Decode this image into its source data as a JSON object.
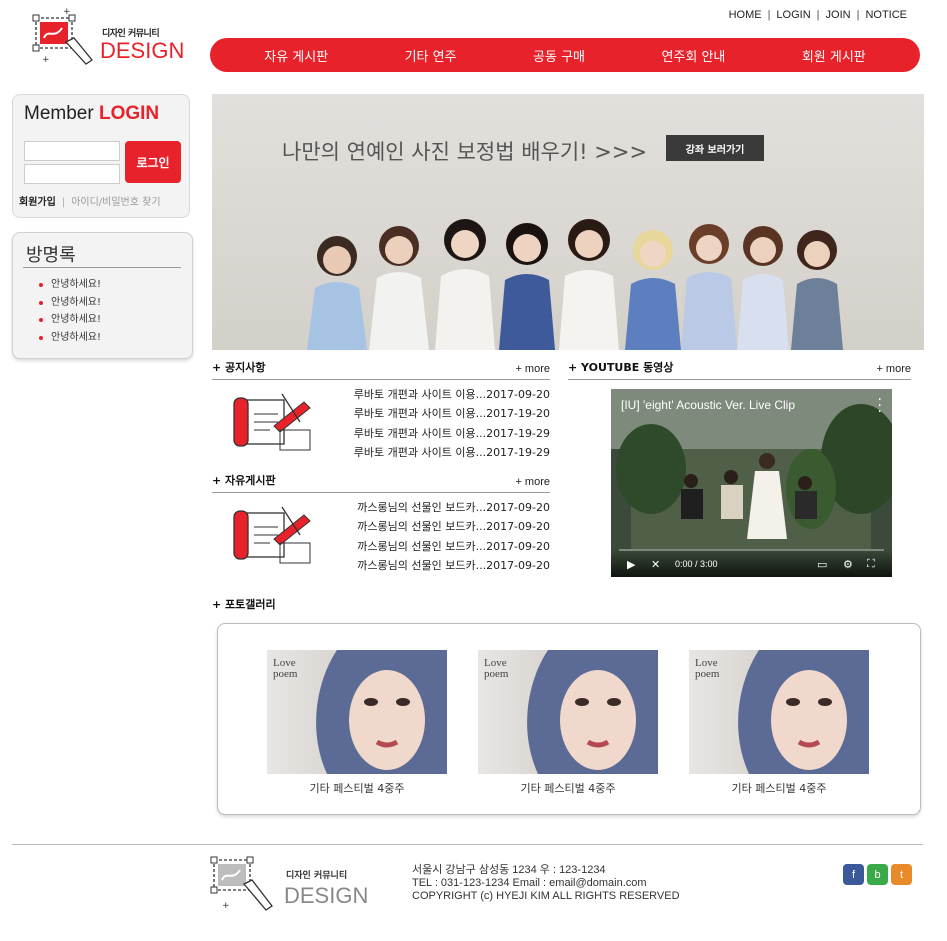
{
  "header": {
    "brand_small": "디자인 커뮤니티",
    "brand_big": "DESIGN",
    "top_links": [
      "HOME",
      "LOGIN",
      "JOIN",
      "NOTICE"
    ],
    "nav": [
      "자유 게시판",
      "기타 연주",
      "공동 구매",
      "연주회 안내",
      "회원 게시판"
    ]
  },
  "login": {
    "title_a": "Member ",
    "title_b": "LOGIN",
    "button": "로그인",
    "join": "회원가입",
    "find": "아이디/비밀번호 찾기"
  },
  "guestbook": {
    "title": "방명록",
    "items": [
      "안녕하세요!",
      "안녕하세요!",
      "안녕하세요!",
      "안녕하세요!"
    ]
  },
  "banner": {
    "text": "나만의 연예인 사진 보정법 배우기! >>>",
    "button": "강좌 보러가기"
  },
  "notice": {
    "title": "+ 공지사항",
    "more": "+ more",
    "items": [
      "루바토 개편과 사이트 이용...2017-09-20",
      "루바토 개편과 사이트 이용...2017-19-20",
      "루바토 개편과 사이트 이용...2017-19-29",
      "루바토 개편과 사이트 이용...2017-19-29"
    ]
  },
  "freeboard": {
    "title": "+ 자유게시판",
    "more": "+ more",
    "items": [
      "까스롱님의 선물인 보드카...2017-09-20",
      "까스롱님의 선물인 보드카...2017-09-20",
      "까스롱님의 선물인 보드카...2017-09-20",
      "까스롱님의 선물인 보드카...2017-09-20"
    ]
  },
  "youtube": {
    "title": "+ YOUTUBE 동영상",
    "more": "+ more",
    "video_title": "[IU] 'eight' Acoustic Ver. Live Clip",
    "time": "0:00 / 3:00"
  },
  "gallery": {
    "title": "+ 포토갤러리",
    "poster_title_1": "Love",
    "poster_title_2": "poem",
    "items": [
      {
        "caption": "기타 페스티벌 4중주"
      },
      {
        "caption": "기타 페스티벌 4중주"
      },
      {
        "caption": "기타 페스티벌 4중주"
      }
    ]
  },
  "footer": {
    "brand_small": "디자인 커뮤니티",
    "brand_big": "DESIGN",
    "address": "서울시 강남구 삼성동 1234 우 : 123-1234",
    "contact": "TEL : 031-123-1234 Email : email@domain.com",
    "copyright": "COPYRIGHT (c) HYEJI KIM ALL RIGHTS RESERVED",
    "sns": [
      {
        "label": "f",
        "color": "#3b5998"
      },
      {
        "label": "b",
        "color": "#3aaa49"
      },
      {
        "label": "t",
        "color": "#e8892a"
      }
    ]
  },
  "colors": {
    "accent": "#e8222a"
  }
}
